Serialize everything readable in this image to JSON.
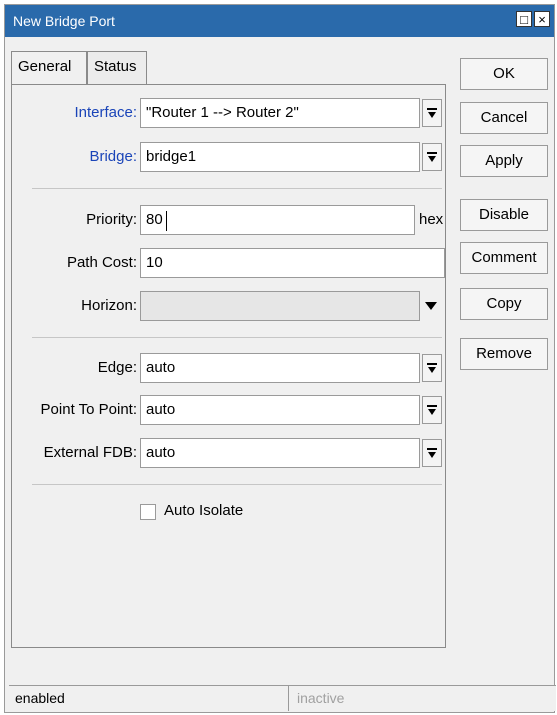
{
  "window": {
    "title": "New Bridge Port",
    "title_buttons": [
      "□",
      "×"
    ]
  },
  "tabs": [
    {
      "label": "General",
      "active": true
    },
    {
      "label": "Status",
      "active": false
    }
  ],
  "fields": {
    "interface": {
      "label": "Interface:",
      "value": "\"Router 1 --> Router 2\""
    },
    "bridge": {
      "label": "Bridge:",
      "value": "bridge1"
    },
    "priority": {
      "label": "Priority:",
      "value": "80",
      "suffix": "hex"
    },
    "path_cost": {
      "label": "Path Cost:",
      "value": "10"
    },
    "horizon": {
      "label": "Horizon:",
      "value": ""
    },
    "edge": {
      "label": "Edge:",
      "value": "auto"
    },
    "point_to_point": {
      "label": "Point To Point:",
      "value": "auto"
    },
    "external_fdb": {
      "label": "External FDB:",
      "value": "auto"
    }
  },
  "auto_isolate": {
    "label": "Auto Isolate",
    "checked": false
  },
  "buttons": {
    "ok": "OK",
    "cancel": "Cancel",
    "apply": "Apply",
    "disable": "Disable",
    "comment": "Comment",
    "copy": "Copy",
    "remove": "Remove"
  },
  "status": {
    "left": "enabled",
    "right": "inactive"
  },
  "colors": {
    "titlebar": "#2a6aab",
    "label_link": "#1a44b8"
  }
}
